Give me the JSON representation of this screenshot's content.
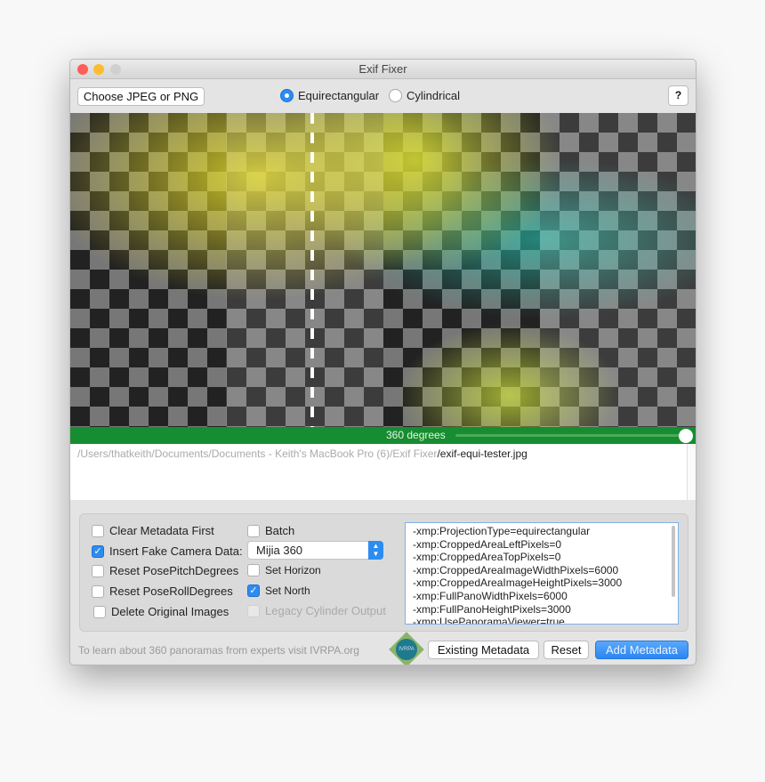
{
  "window": {
    "title": "Exif Fixer"
  },
  "toolbar": {
    "choose_label": "Choose JPEG or PNG",
    "projection_options": [
      {
        "label": "Equirectangular",
        "selected": true
      },
      {
        "label": "Cylindrical",
        "selected": false
      }
    ],
    "help_label": "?"
  },
  "slider": {
    "label": "360 degrees",
    "value_percent": 100
  },
  "path": {
    "dir": "/Users/thatkeith/Documents/Documents - Keith's MacBook Pro (6)/Exif Fixer",
    "file": "/exif-equi-tester.jpg"
  },
  "options": {
    "clear_metadata": {
      "label": "Clear Metadata First",
      "checked": false
    },
    "batch": {
      "label": "Batch",
      "checked": false
    },
    "fake_camera": {
      "label": "Insert Fake Camera Data:",
      "checked": true
    },
    "camera_select": "Mijia 360",
    "reset_pitch": {
      "label": "Reset PosePitchDegrees",
      "checked": false
    },
    "set_horizon": {
      "label": "Set Horizon",
      "checked": false
    },
    "reset_roll": {
      "label": "Reset PoseRollDegrees",
      "checked": false
    },
    "set_north": {
      "label": "Set North",
      "checked": true
    },
    "delete_originals": {
      "label": "Delete Original Images",
      "checked": false
    },
    "legacy_cylinder": {
      "label": "Legacy Cylinder Output",
      "checked": false,
      "disabled": true
    }
  },
  "metadata_lines": [
    "-xmp:ProjectionType=equirectangular",
    "-xmp:CroppedAreaLeftPixels=0",
    "-xmp:CroppedAreaTopPixels=0",
    "-xmp:CroppedAreaImageWidthPixels=6000",
    "-xmp:CroppedAreaImageHeightPixels=3000",
    "-xmp:FullPanoWidthPixels=6000",
    "-xmp:FullPanoHeightPixels=3000",
    "-xmp:UsePanoramaViewer=true"
  ],
  "footer": {
    "info": "To learn about 360 panoramas from experts visit IVRPA.org",
    "logo_text": "IVRPA",
    "existing_label": "Existing Metadata",
    "reset_label": "Reset",
    "add_label": "Add Metadata"
  },
  "colors": {
    "accent": "#2d8cf0",
    "slider_bar": "#168d30"
  }
}
